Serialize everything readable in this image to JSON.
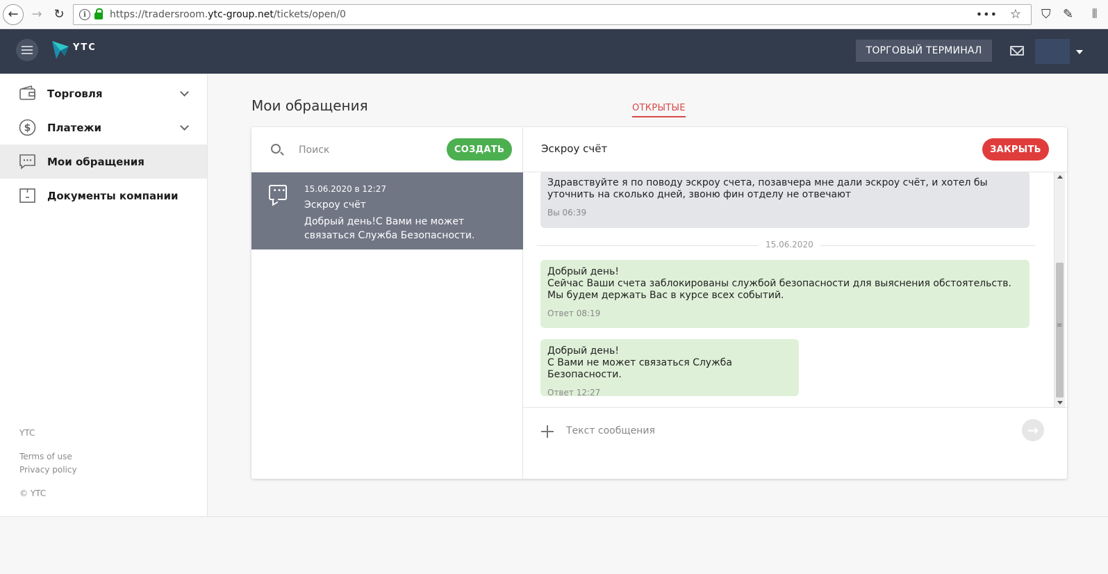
{
  "browser": {
    "url_prefix": "https://tradersroom.",
    "url_domain": "ytc-group.net",
    "url_path": "/tickets/open/0",
    "menu_dots": "•••"
  },
  "header": {
    "logo_text": "YTC",
    "terminal_button": "ТОРГОВЫЙ ТЕРМИНАЛ"
  },
  "sidebar": {
    "items": [
      {
        "label": "Торговля"
      },
      {
        "label": "Платежи"
      },
      {
        "label": "Мои обращения"
      },
      {
        "label": "Документы компании"
      }
    ],
    "footer": {
      "brand": "YTC",
      "terms": "Terms of use",
      "privacy": "Privacy policy",
      "copyright": "© YTC"
    }
  },
  "main": {
    "title": "Мои обращения",
    "tab_open": "ОТКРЫТЫЕ"
  },
  "tickets": {
    "search_placeholder": "Поиск",
    "create_button": "СОЗДАТЬ",
    "list": [
      {
        "date": "15.06.2020 в 12:27",
        "title": "Эскроу счёт",
        "preview": "Добрый день!С Вами не может связаться Служба Безопасности."
      }
    ]
  },
  "chat": {
    "title": "Эскроу счёт",
    "close_button": "ЗАКРЫТЬ",
    "date_separator": "15.06.2020",
    "messages": [
      {
        "text": "Здравствуйте я по поводу эскроу счета, позавчера мне дали эскроу счёт, и хотел бы уточнить на сколько дней, звоню фин отделу не отвечают",
        "time": "Вы 06:39"
      },
      {
        "line1": "Добрый день!",
        "line2": "Сейчас Ваши счета заблокированы службой безопасности для выяснения обстоятельств. Мы будем держать Вас в курсе всех событий.",
        "time": "Ответ 08:19"
      },
      {
        "line1": "Добрый день!",
        "line2": "С Вами не может связаться Служба Безопасности.",
        "time": "Ответ 12:27"
      }
    ],
    "input_placeholder": "Текст сообщения"
  }
}
